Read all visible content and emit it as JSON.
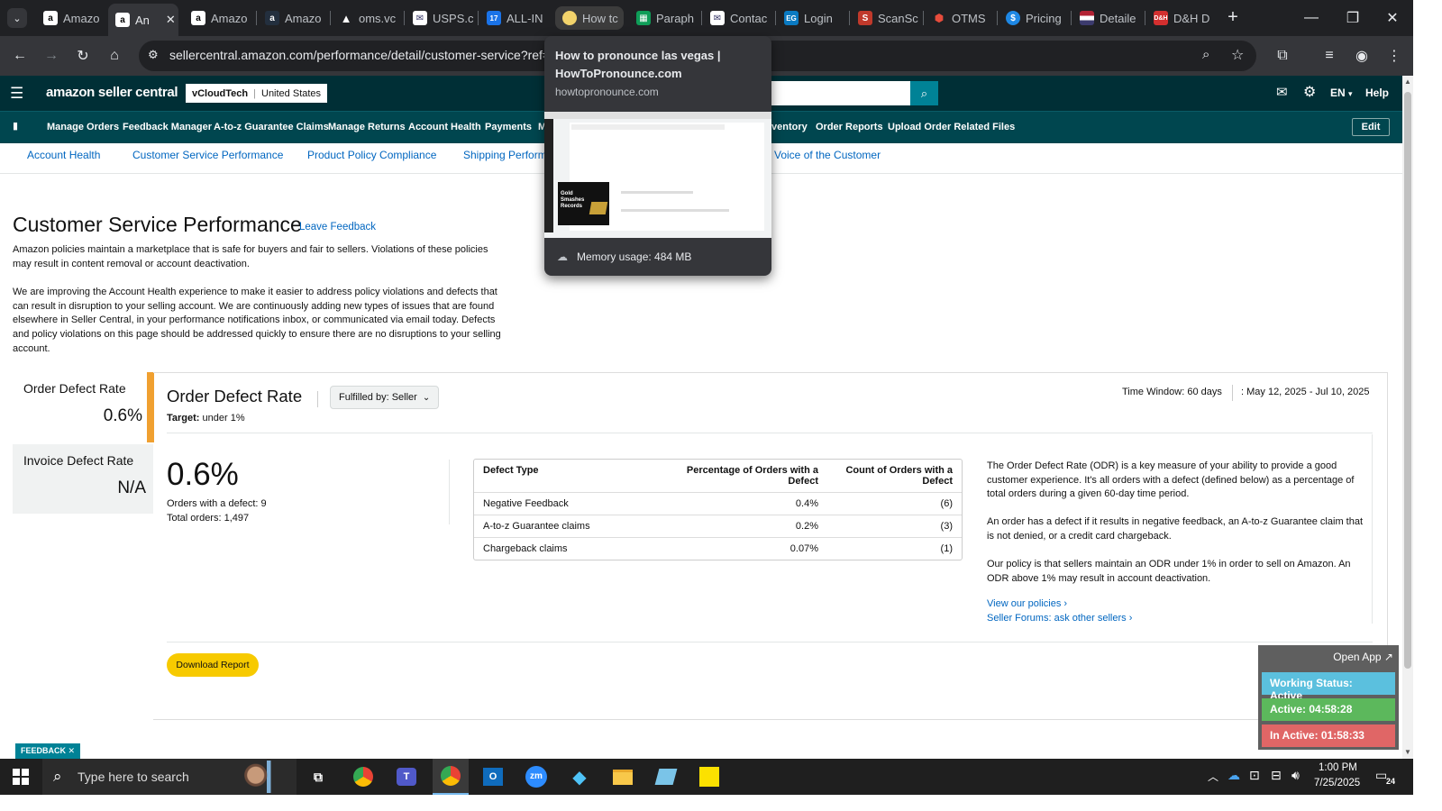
{
  "browser": {
    "tabs": [
      {
        "label": "Amazo",
        "favicon": "amazon-icon"
      },
      {
        "label": "An",
        "favicon": "amazon-icon",
        "active": true
      },
      {
        "label": "Amazo",
        "favicon": "amazon-icon"
      },
      {
        "label": "Amazo",
        "favicon": "amazon-icon"
      },
      {
        "label": "oms.vc",
        "favicon": "oms-icon"
      },
      {
        "label": "USPS.c",
        "favicon": "usps-icon"
      },
      {
        "label": "ALL-IN",
        "favicon": "17track-icon"
      },
      {
        "label": "How tc",
        "favicon": "howtopronounce-icon"
      },
      {
        "label": "Paraph",
        "favicon": "sheets-icon"
      },
      {
        "label": "Contac",
        "favicon": "usps-icon"
      },
      {
        "label": "Login",
        "favicon": "ecg-icon"
      },
      {
        "label": "ScanSc",
        "favicon": "scanscope-icon"
      },
      {
        "label": "OTMS",
        "favicon": "otms-icon"
      },
      {
        "label": "Pricing",
        "favicon": "pricing-icon"
      },
      {
        "label": "Detaile",
        "favicon": "flag-icon"
      },
      {
        "label": "D&H D",
        "favicon": "dh-icon"
      }
    ],
    "url": "sellercentral.amazon.com/performance/detail/customer-service?ref="
  },
  "tooltip": {
    "title": "How to pronounce las vegas | HowToPronounce.com",
    "domain": "howtopronounce.com",
    "thumb_text": "Gold Smashes Records",
    "memory": "Memory usage: 484 MB"
  },
  "header": {
    "logo": "amazon seller central",
    "account": "vCloudTech",
    "marketplace": "United States",
    "lang": "EN",
    "help": "Help"
  },
  "nav": {
    "items": [
      "Manage Orders",
      "Feedback Manager",
      "A-to-z Guarantee Claims",
      "Manage Returns",
      "Account Health",
      "Payments",
      "M",
      "ventory",
      "Order Reports",
      "Upload Order Related Files"
    ],
    "edit": "Edit"
  },
  "subnav": {
    "items": [
      "Account Health",
      "Customer Service Performance",
      "Product Policy Compliance",
      "Shipping Perform",
      "Voice of the Customer"
    ]
  },
  "page": {
    "title": "Customer Service Performance",
    "leave_feedback": "Leave Feedback",
    "intro1": "Amazon policies maintain a marketplace that is safe for buyers and fair to sellers. Violations of these policies may result in content removal or account deactivation.",
    "intro2": "We are improving the Account Health experience to make it easier to address policy violations and defects that can result in disruption to your selling account. We are continuously adding new types of issues that are found elsewhere in Seller Central, in your performance notifications inbox, or communicated via email today. Defects and policy violations on this page should be addressed quickly to ensure there are no disruptions to your selling account."
  },
  "metrics": [
    {
      "label": "Order Defect Rate",
      "value": "0.6%"
    },
    {
      "label": "Invoice Defect Rate",
      "value": "N/A"
    }
  ],
  "odr": {
    "title": "Order Defect Rate",
    "filter": "Fulfilled by: Seller",
    "target_label": "Target:",
    "target_value": "under 1%",
    "time_window": "Time Window: 60 days",
    "date_range": ": May 12, 2025 - Jul 10, 2025",
    "big_value": "0.6%",
    "orders_defect": "Orders with a defect: 9",
    "total_orders": "Total orders: 1,497",
    "table": {
      "headers": [
        "Defect Type",
        "Percentage of Orders with a Defect",
        "Count of Orders with a Defect"
      ],
      "rows": [
        [
          "Negative Feedback",
          "0.4%",
          "(6)"
        ],
        [
          "A-to-z Guarantee claims",
          "0.2%",
          "(3)"
        ],
        [
          "Chargeback claims",
          "0.07%",
          "(1)"
        ]
      ]
    },
    "desc1": "The Order Defect Rate (ODR) is a key measure of your ability to provide a good customer experience. It's all orders with a defect (defined below) as a percentage of total orders during a given 60-day time period.",
    "desc2": "An order has a defect if it results in negative feedback, an A-to-z Guarantee claim that is not denied, or a credit card chargeback.",
    "desc3": "Our policy is that sellers maintain an ODR under 1% in order to sell on Amazon. An ODR above 1% may result in account deactivation.",
    "link1": "View our policies ›",
    "link2": "Seller Forums: ask other sellers ›",
    "download": "Download Report"
  },
  "feedback_tag": "FEEDBACK",
  "widget": {
    "open_app": "Open App ↗",
    "status": "Working Status: Active",
    "active": "Active: 04:58:28",
    "inactive": "In Active: 01:58:33"
  },
  "taskbar": {
    "search_placeholder": "Type here to search",
    "time": "1:00 PM",
    "date": "7/25/2025",
    "notif_count": "24"
  },
  "colors": {
    "header_bg": "#002f36",
    "nav_bg": "#00464f",
    "link": "#0066c0",
    "accent_orange": "#f0a030",
    "download_btn": "#f7ca00",
    "widget_status": "#5bc0de",
    "widget_active": "#5cb85c",
    "widget_inactive": "#e06666"
  }
}
